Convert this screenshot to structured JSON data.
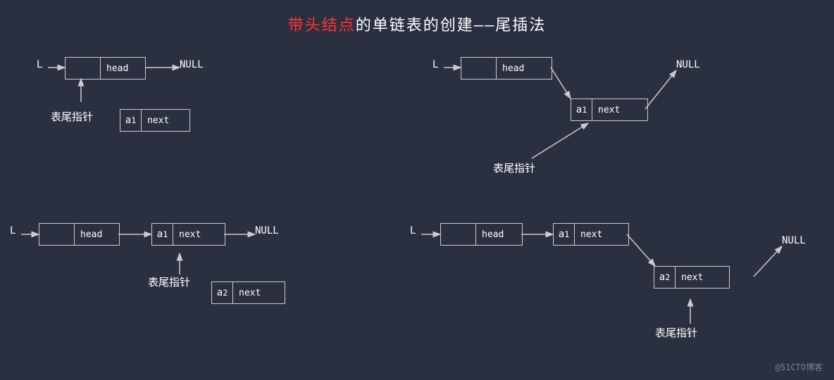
{
  "title": {
    "prefix": "带头结点",
    "highlight": "带头结点",
    "suffix": "的单链表的创建——尾插法",
    "full_prefix": "",
    "full_text": "带头结点的单链表的创建——尾插法"
  },
  "watermark": "@51CTO博客",
  "diagrams": {
    "d1": {
      "L_label": "L",
      "head_node": "head",
      "next_label": "NULL",
      "tail_label": "表尾指针",
      "a1_data": "a₁",
      "a1_next": "next"
    }
  }
}
